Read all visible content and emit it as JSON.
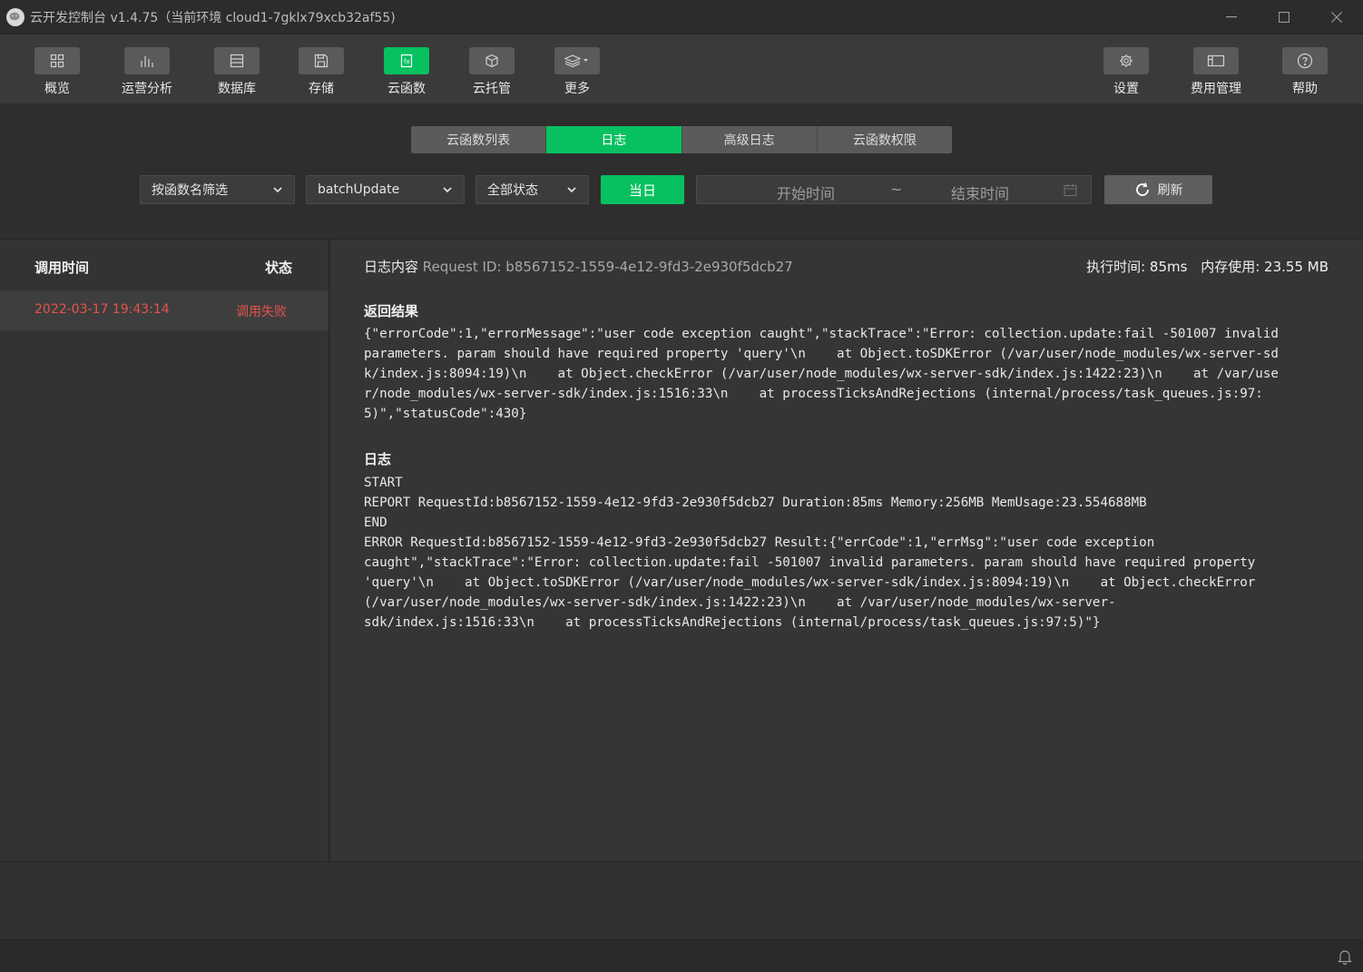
{
  "window": {
    "title": "云开发控制台 v1.4.75（当前环境 cloud1-7gklx79xcb32af55)"
  },
  "toolbar": {
    "left_items": [
      {
        "label": "概览",
        "icon": "grid-icon"
      },
      {
        "label": "运营分析",
        "icon": "bar-chart-icon"
      },
      {
        "label": "数据库",
        "icon": "database-icon"
      },
      {
        "label": "存储",
        "icon": "save-icon"
      },
      {
        "label": "云函数",
        "icon": "function-icon",
        "active": true
      },
      {
        "label": "云托管",
        "icon": "cube-icon"
      },
      {
        "label": "更多",
        "icon": "layers-icon"
      }
    ],
    "right_items": [
      {
        "label": "设置",
        "icon": "gear-icon"
      },
      {
        "label": "费用管理",
        "icon": "billing-icon"
      },
      {
        "label": "帮助",
        "icon": "help-icon"
      }
    ]
  },
  "tabs": [
    "云函数列表",
    "日志",
    "高级日志",
    "云函数权限"
  ],
  "active_tab": "日志",
  "filters": {
    "filter_type": "按函数名筛选",
    "function_name": "batchUpdate",
    "status": "全部状态",
    "today_label": "当日",
    "start_placeholder": "开始时间",
    "separator": "~",
    "end_placeholder": "结束时间",
    "refresh_label": "刷新"
  },
  "invocations": {
    "col_time": "调用时间",
    "col_status": "状态",
    "rows": [
      {
        "time": "2022-03-17 19:43:14",
        "status": "调用失败"
      }
    ]
  },
  "log_detail": {
    "heading": "日志内容",
    "request_id": "Request ID: b8567152-1559-4e12-9fd3-2e930f5dcb27",
    "exec_time": "执行时间: 85ms",
    "memory": "内存使用: 23.55 MB",
    "return_title": "返回结果",
    "return_lines": [
      "{\"errorCode\":1,\"errorMessage\":\"user code exception caught\",\"stackTrace\":\"Error: collection.update:fail -501007 invalid",
      "parameters. param should have required property 'query'\\n    at Object.toSDKError (/var/user/node_modules/wx-server-sd",
      "k/index.js:8094:19)\\n    at Object.checkError (/var/user/node_modules/wx-server-sdk/index.js:1422:23)\\n    at /var/use",
      "r/node_modules/wx-server-sdk/index.js:1516:33\\n    at processTicksAndRejections (internal/process/task_queues.js:97:",
      "5)\",\"statusCode\":430}"
    ],
    "log_title": "日志",
    "log_lines": [
      "START",
      "REPORT RequestId:b8567152-1559-4e12-9fd3-2e930f5dcb27 Duration:85ms Memory:256MB MemUsage:23.554688MB",
      "END",
      "ERROR RequestId:b8567152-1559-4e12-9fd3-2e930f5dcb27 Result:{\"errCode\":1,\"errMsg\":\"user code exception",
      "caught\",\"stackTrace\":\"Error: collection.update:fail -501007 invalid parameters. param should have required property",
      "'query'\\n    at Object.toSDKError (/var/user/node_modules/wx-server-sdk/index.js:8094:19)\\n    at Object.checkError",
      "(/var/user/node_modules/wx-server-sdk/index.js:1422:23)\\n    at /var/user/node_modules/wx-server-",
      "sdk/index.js:1516:33\\n    at processTicksAndRejections (internal/process/task_queues.js:97:5)\"}"
    ]
  },
  "colors": {
    "accent": "#07c160",
    "error": "#e5534b",
    "background": "#2e2e2e"
  }
}
